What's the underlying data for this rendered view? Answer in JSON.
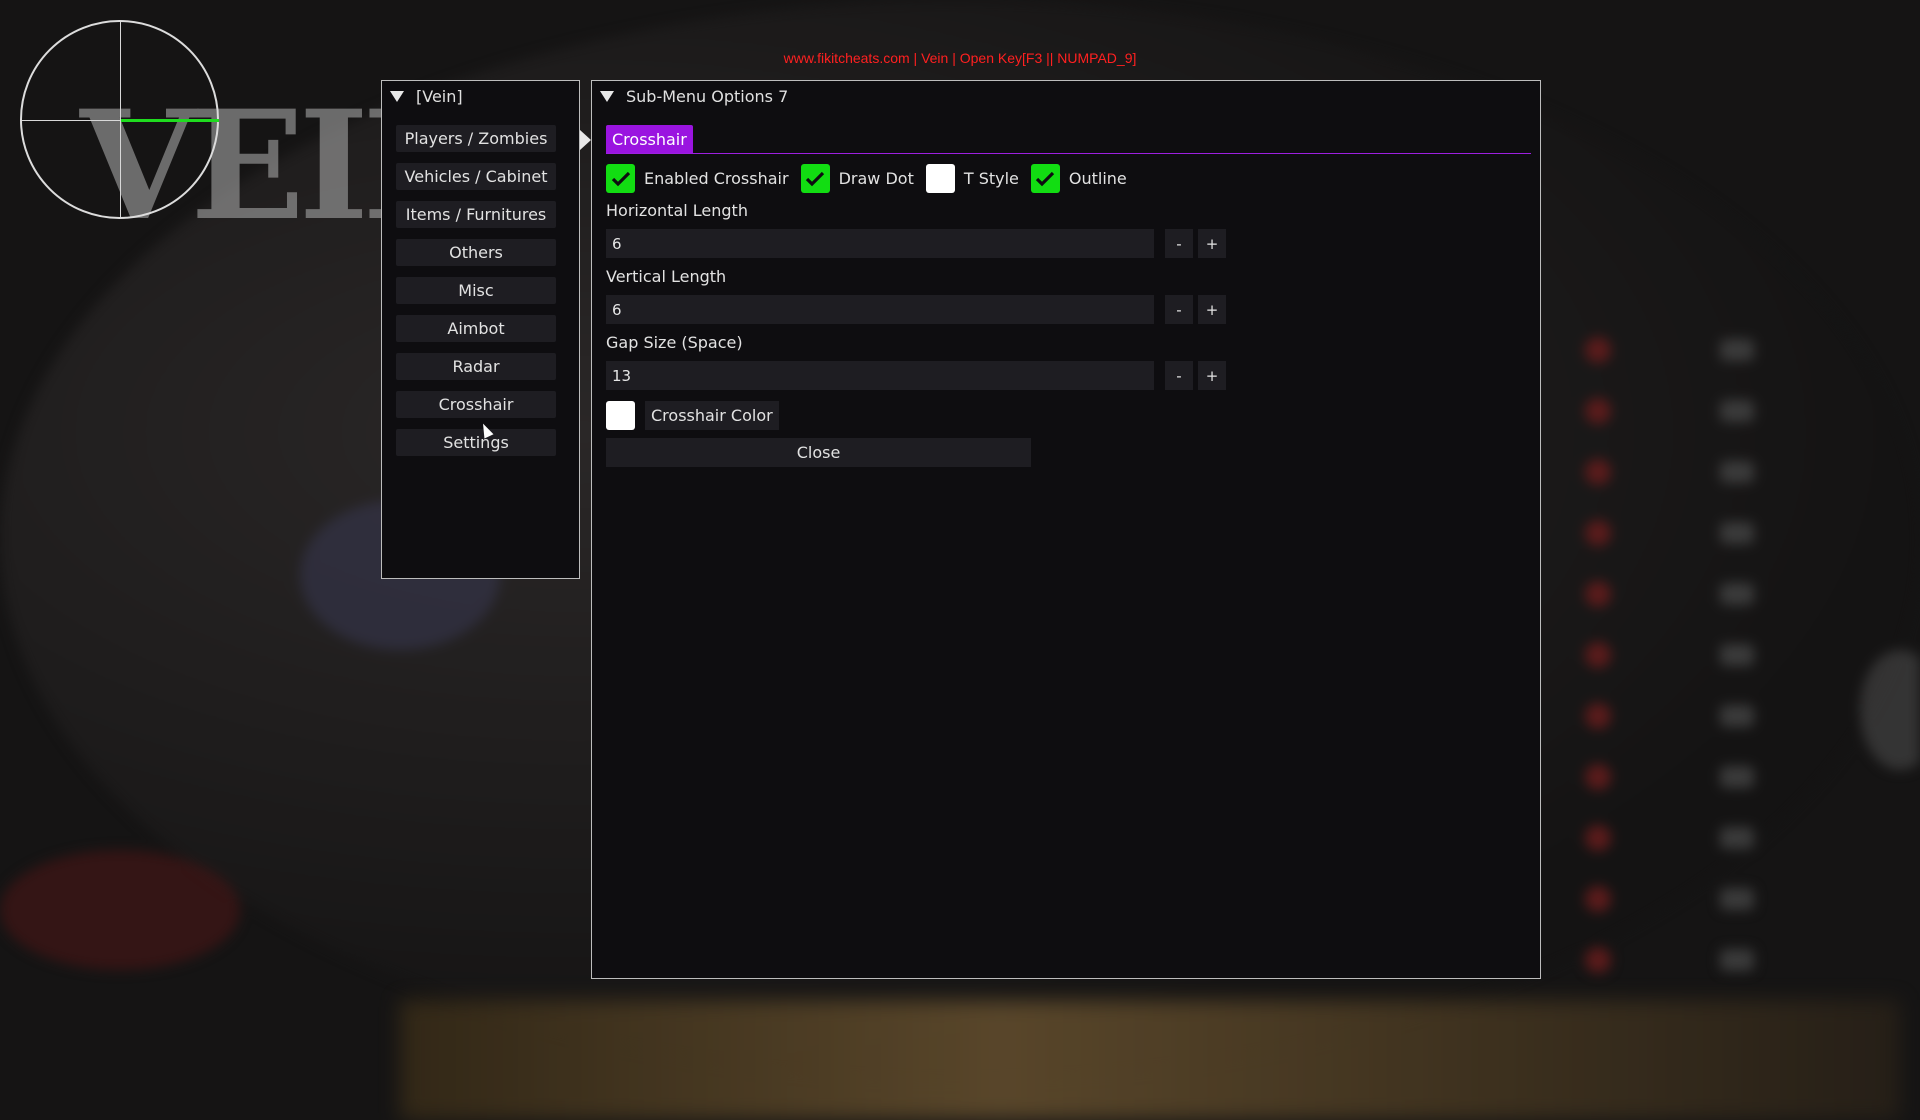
{
  "watermark": "www.fikitcheats.com | Vein | Open Key[F3 || NUMPAD_9]",
  "background_logo": "VEIN",
  "left_window": {
    "title": "[Vein]",
    "menu_items": [
      "Players / Zombies",
      "Vehicles / Cabinet",
      "Items / Furnitures",
      "Others",
      "Misc",
      "Aimbot",
      "Radar",
      "Crosshair",
      "Settings"
    ]
  },
  "right_window": {
    "title": "Sub-Menu Options 7",
    "tabs": [
      "Crosshair"
    ],
    "checkboxes": [
      {
        "label": "Enabled Crosshair",
        "checked": true
      },
      {
        "label": "Draw Dot",
        "checked": true
      },
      {
        "label": "T Style",
        "checked": false
      },
      {
        "label": "Outline",
        "checked": true
      }
    ],
    "fields": [
      {
        "label": "Horizontal Length",
        "value": "6"
      },
      {
        "label": "Vertical Length",
        "value": "6"
      },
      {
        "label": "Gap Size (Space)",
        "value": "13"
      }
    ],
    "decrement_label": "-",
    "increment_label": "+",
    "color_label": "Crosshair Color",
    "close_label": "Close"
  },
  "colors": {
    "accent": "#9a14e0",
    "check_on": "#12dd12",
    "watermark": "#ff2020",
    "radar_line": "#1fdc1f"
  }
}
